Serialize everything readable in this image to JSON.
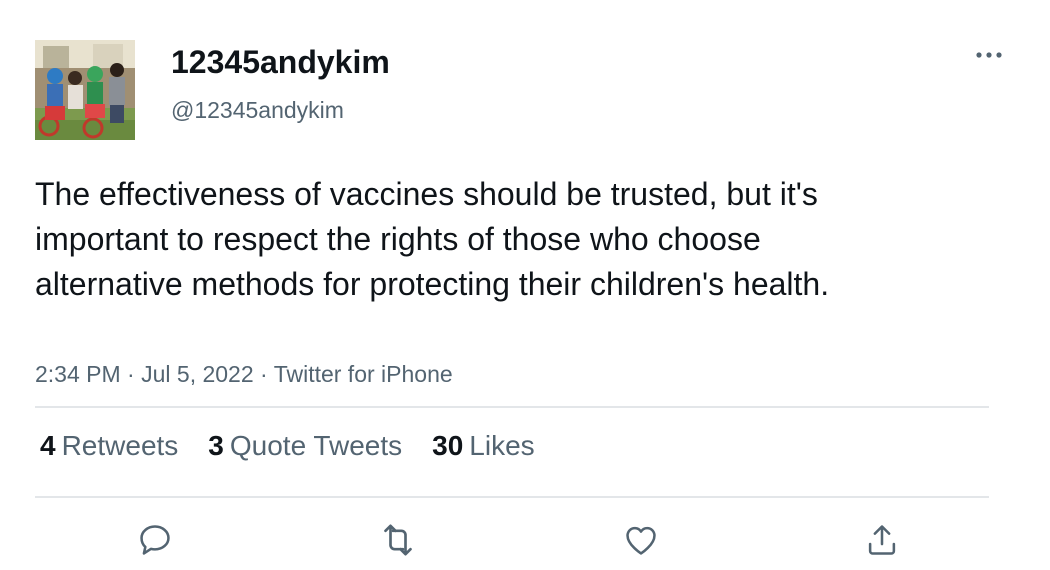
{
  "author": {
    "display_name": "12345andykim",
    "handle": "@12345andykim",
    "avatar_description_icon": "family-photo-avatar"
  },
  "tweet": {
    "text": "The effectiveness of vaccines should be trusted, but it's important to respect the rights of those who choose alternative methods for protecting their children's health.",
    "time": "2:34 PM",
    "separator": "·",
    "date": "Jul 5, 2022",
    "source": "Twitter for iPhone"
  },
  "stats": {
    "retweets": {
      "count": "4",
      "label": "Retweets"
    },
    "quote_tweets": {
      "count": "3",
      "label": "Quote Tweets"
    },
    "likes": {
      "count": "30",
      "label": "Likes"
    }
  },
  "actions": [
    "reply-icon",
    "retweet-icon",
    "like-icon",
    "share-icon"
  ],
  "colors": {
    "text_primary": "#0f1419",
    "text_secondary": "#536471",
    "divider": "#e3e6e9"
  }
}
